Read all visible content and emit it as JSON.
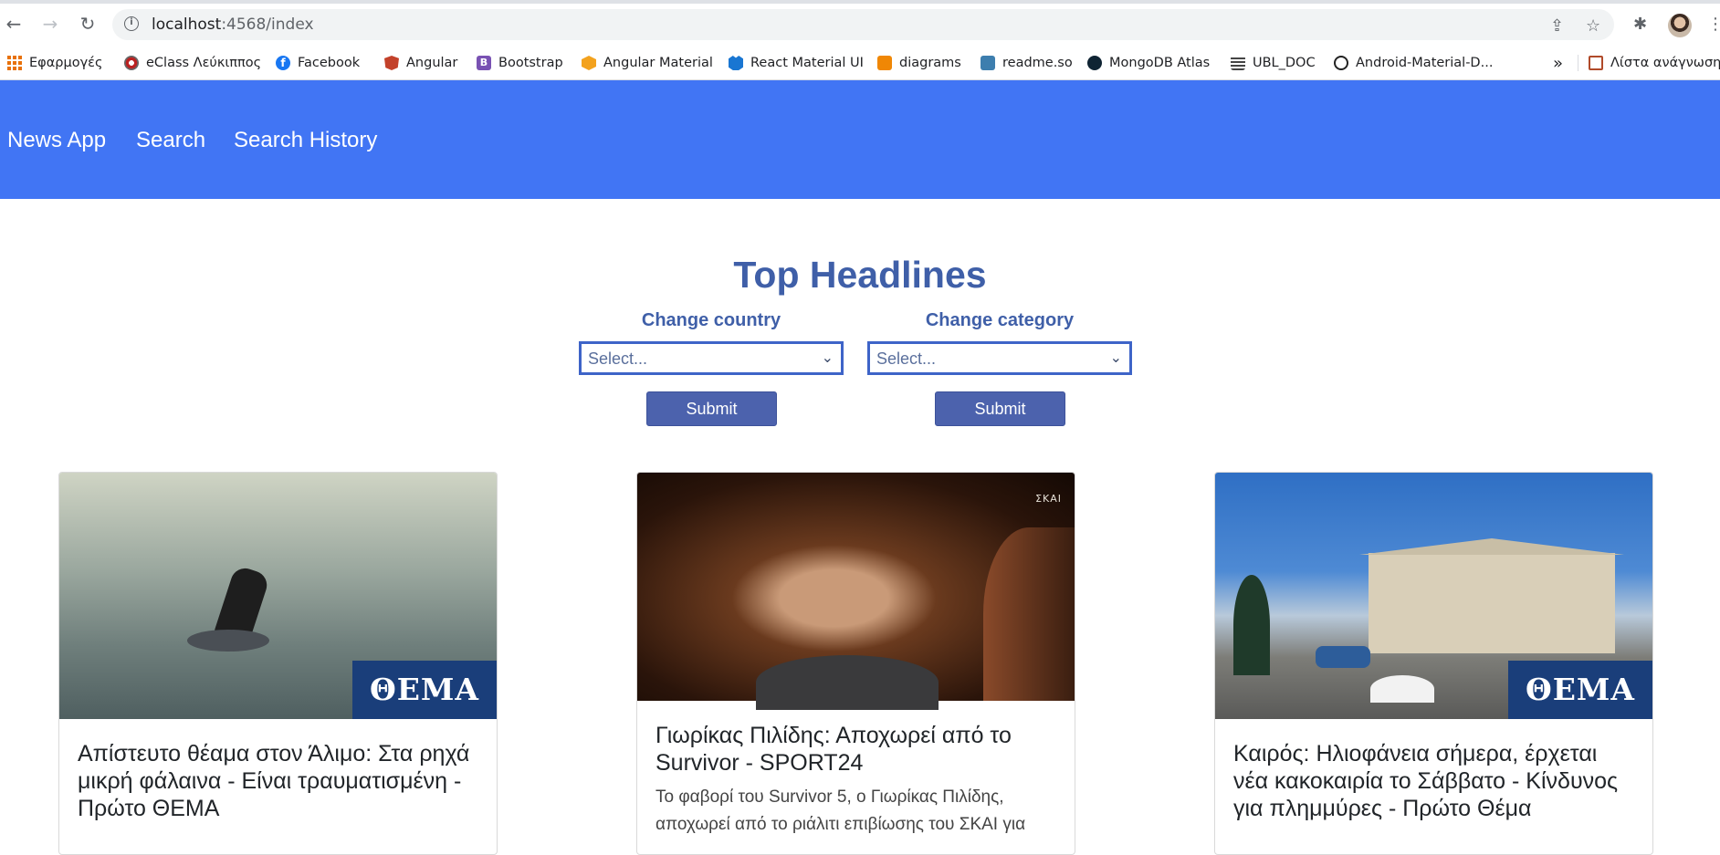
{
  "browser": {
    "url_host": "localhost",
    "url_rest": ":4568/index",
    "bookmarks": [
      {
        "label": "Εφαρμογές",
        "icon": "apps-icon"
      },
      {
        "label": "eClass Λεύκιππος",
        "icon": "eclass-icon"
      },
      {
        "label": "Facebook",
        "icon": "facebook-icon"
      },
      {
        "label": "Angular",
        "icon": "angular-icon"
      },
      {
        "label": "Bootstrap",
        "icon": "bootstrap-icon"
      },
      {
        "label": "Angular Material",
        "icon": "angular-material-icon"
      },
      {
        "label": "React Material UI",
        "icon": "material-ui-icon"
      },
      {
        "label": "diagrams",
        "icon": "diagrams-icon"
      },
      {
        "label": "readme.so",
        "icon": "readme-icon"
      },
      {
        "label": "MongoDB Atlas",
        "icon": "mongodb-icon"
      },
      {
        "label": "UBL_DOC",
        "icon": "ubl-icon"
      },
      {
        "label": "Android-Material-D...",
        "icon": "github-icon"
      }
    ],
    "more_bookmarks": "»",
    "reading_list": "Λίστα ανάγνωσης"
  },
  "nav": {
    "brand": "News App",
    "links": [
      "Search",
      "Search History"
    ]
  },
  "main": {
    "title": "Top Headlines",
    "country": {
      "label": "Change country",
      "placeholder": "Select...",
      "submit": "Submit"
    },
    "category": {
      "label": "Change category",
      "placeholder": "Select...",
      "submit": "Submit"
    }
  },
  "articles": [
    {
      "title": "Απίστευτο θέαμα στον Άλιμο: Στα ρηχά μικρή φάλαινα - Είναι τραυματισμένη - Πρώτο ΘΕΜΑ",
      "badge": "ΘΕΜΑ",
      "image": "whale-diver-photo"
    },
    {
      "title": "Γιωρίκας Πιλίδης: Αποχωρεί από το Survivor - SPORT24",
      "description": "Το φαβορί του Survivor 5, ο Γιωρίκας Πιλίδης, αποχωρεί από το ριάλιτι επιβίωσης του ΣΚΑΙ για",
      "watermark": "ΣΚΑΙ",
      "image": "survivor-contestant-photo"
    },
    {
      "title": "Καιρός: Ηλιοφάνεια σήμερα, έρχεται νέα κακοκαιρία το Σάββατο - Κίνδυνος για πλημμύρες - Πρώτο Θέμα",
      "badge": "ΘΕΜΑ",
      "image": "parliament-snow-photo"
    }
  ]
}
